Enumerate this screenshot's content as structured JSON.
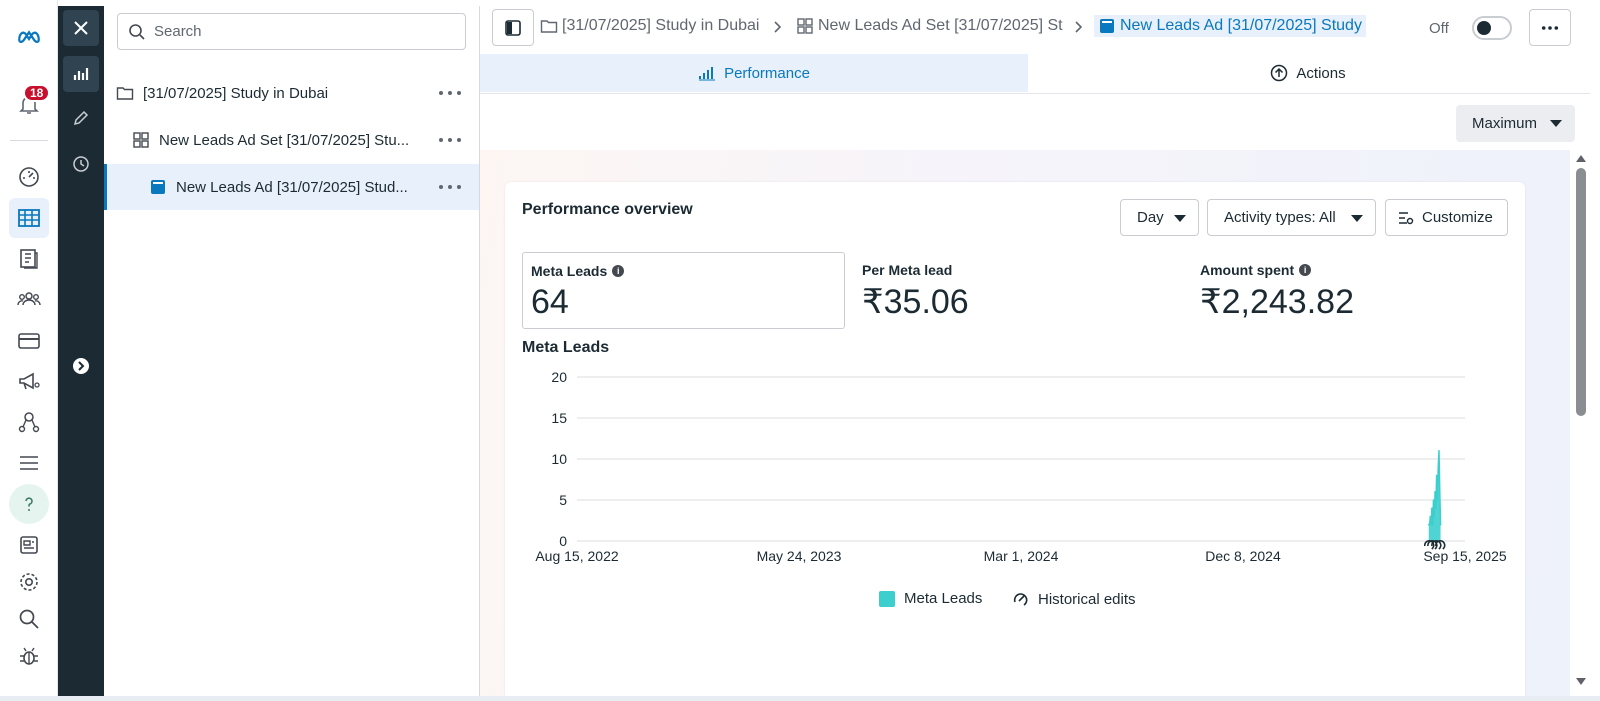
{
  "app": {
    "notifications_count": "18"
  },
  "search": {
    "placeholder": "Search"
  },
  "tree": {
    "items": [
      {
        "label": "[31/07/2025] Study in Dubai",
        "type": "campaign"
      },
      {
        "label": "New Leads Ad Set [31/07/2025] Stu...",
        "type": "adset"
      },
      {
        "label": "New Leads Ad [31/07/2025] Stud...",
        "type": "ad"
      }
    ]
  },
  "breadcrumb": {
    "campaign": "[31/07/2025] Study in Dubai",
    "adset": "New Leads Ad Set [31/07/2025] St",
    "ad": "New Leads Ad [31/07/2025] Study"
  },
  "status": {
    "toggle_label": "Off",
    "is_on": false
  },
  "tabs": {
    "performance": "Performance",
    "actions": "Actions"
  },
  "range": {
    "selected": "Maximum"
  },
  "overview": {
    "title": "Performance overview",
    "granularity": "Day",
    "activity_filter": "Activity types: All",
    "customize": "Customize"
  },
  "metrics": [
    {
      "label": "Meta Leads",
      "value": "64"
    },
    {
      "label": "Per Meta lead",
      "value": "₹35.06"
    },
    {
      "label": "Amount spent",
      "value": "₹2,243.82"
    }
  ],
  "chart_section_title": "Meta Leads",
  "colors": {
    "accent": "#0a78be",
    "series": "#3dcfce",
    "dark_rail": "#1c2b33",
    "badge": "#c8102e"
  },
  "chart_data": {
    "type": "area",
    "title": "Meta Leads",
    "xlabel": "",
    "ylabel": "",
    "x_tick_labels": [
      "Aug 15, 2022",
      "May 24, 2023",
      "Mar 1, 2024",
      "Dec 8, 2024",
      "Sep 15, 2025"
    ],
    "x_range": [
      "2022-08-15",
      "2025-09-15"
    ],
    "ylim": [
      0,
      20
    ],
    "y_ticks": [
      0,
      5,
      10,
      15,
      20
    ],
    "grid": true,
    "legend": "bottom-center",
    "legend_entries": [
      "Meta Leads",
      "Historical edits"
    ],
    "series": [
      {
        "name": "Meta Leads",
        "x": [
          "2025-07-31",
          "2025-08-01",
          "2025-08-02",
          "2025-08-03",
          "2025-08-04",
          "2025-08-05",
          "2025-08-06",
          "2025-08-07",
          "2025-08-08",
          "2025-08-09",
          "2025-08-10",
          "2025-08-11",
          "2025-08-12",
          "2025-08-13",
          "2025-08-14",
          "2025-08-15"
        ],
        "values": [
          2,
          2,
          3,
          2,
          4,
          2,
          5,
          3,
          6,
          4,
          8,
          5,
          9,
          11,
          6,
          2
        ]
      }
    ],
    "historical_edits": [
      "2025-07-31",
      "2025-08-04",
      "2025-08-09",
      "2025-08-14"
    ]
  }
}
